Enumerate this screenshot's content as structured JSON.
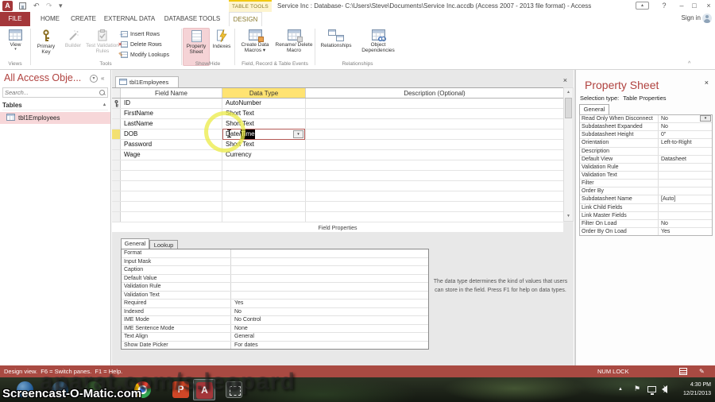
{
  "window": {
    "title": "Service Inc : Database- C:\\Users\\Steve\\Documents\\Service Inc.accdb (Access 2007 - 2013 file format) - Access",
    "app_initial": "A",
    "contextual_group": "TABLE TOOLS",
    "sign_in": "Sign in"
  },
  "tabs": {
    "file": "FILE",
    "home": "HOME",
    "create": "CREATE",
    "external_data": "EXTERNAL DATA",
    "database_tools": "DATABASE TOOLS",
    "design": "DESIGN"
  },
  "ribbon": {
    "view": "View",
    "primary_key": "Primary Key",
    "builder": "Builder",
    "test_validation_rules": "Test Validation Rules",
    "insert_rows": "Insert Rows",
    "delete_rows": "Delete Rows",
    "modify_lookups": "Modify Lookups",
    "property_sheet": "Property Sheet",
    "indexes": "Indexes",
    "create_data_macros": "Create Data Macros ▾",
    "rename_delete_macro": "Rename/ Delete Macro",
    "relationships": "Relationships",
    "object_dependencies": "Object Dependencies",
    "groups": {
      "views": "Views",
      "tools": "Tools",
      "showhide": "Show/Hide",
      "events": "Field, Record & Table Events",
      "relationships": "Relationships"
    }
  },
  "nav": {
    "title": "All Access Obje...",
    "search_placeholder": "Search...",
    "section": "Tables",
    "items": [
      {
        "label": "tbl1Employees"
      }
    ]
  },
  "doc": {
    "tab": "tbl1Employees",
    "grid_headers": {
      "field": "Field Name",
      "type": "Data Type",
      "desc": "Description (Optional)"
    },
    "rows": [
      {
        "name": "ID",
        "type": "AutoNumber"
      },
      {
        "name": "FirstName",
        "type": "Short Text"
      },
      {
        "name": "LastName",
        "type": "Short Text"
      },
      {
        "name": "DOB",
        "type_prefix": "Date/",
        "type_selected": "Time"
      },
      {
        "name": "Password",
        "type": "Short Text"
      },
      {
        "name": "Wage",
        "type": "Currency"
      }
    ],
    "field_properties": {
      "label": "Field Properties",
      "tab_general": "General",
      "tab_lookup": "Lookup",
      "rows": [
        {
          "label": "Format",
          "value": ""
        },
        {
          "label": "Input Mask",
          "value": ""
        },
        {
          "label": "Caption",
          "value": ""
        },
        {
          "label": "Default Value",
          "value": ""
        },
        {
          "label": "Validation Rule",
          "value": ""
        },
        {
          "label": "Validation Text",
          "value": ""
        },
        {
          "label": "Required",
          "value": "Yes"
        },
        {
          "label": "Indexed",
          "value": "No"
        },
        {
          "label": "IME Mode",
          "value": "No Control"
        },
        {
          "label": "IME Sentence Mode",
          "value": "None"
        },
        {
          "label": "Text Align",
          "value": "General"
        },
        {
          "label": "Show Date Picker",
          "value": "For dates"
        }
      ],
      "help": "The data type determines the kind of values that users can store in the field. Press F1 for help on data types."
    }
  },
  "property_sheet": {
    "title": "Property Sheet",
    "selection_label": "Selection type:",
    "selection_value": "Table Properties",
    "tab": "General",
    "rows": [
      {
        "label": "Read Only When Disconnect",
        "value": "No"
      },
      {
        "label": "Subdatasheet Expanded",
        "value": "No"
      },
      {
        "label": "Subdatasheet Height",
        "value": "0\""
      },
      {
        "label": "Orientation",
        "value": "Left-to-Right"
      },
      {
        "label": "Description",
        "value": ""
      },
      {
        "label": "Default View",
        "value": "Datasheet"
      },
      {
        "label": "Validation Rule",
        "value": ""
      },
      {
        "label": "Validation Text",
        "value": ""
      },
      {
        "label": "Filter",
        "value": ""
      },
      {
        "label": "Order By",
        "value": ""
      },
      {
        "label": "Subdatasheet Name",
        "value": "[Auto]"
      },
      {
        "label": "Link Child Fields",
        "value": ""
      },
      {
        "label": "Link Master Fields",
        "value": ""
      },
      {
        "label": "Filter On Load",
        "value": "No"
      },
      {
        "label": "Order By On Load",
        "value": "Yes"
      }
    ]
  },
  "status": {
    "left": "Design view.  F6 = Switch panes.  F1 = Help.",
    "num_lock": "NUM LOCK"
  },
  "taskbar": {
    "ppt_initial": "P",
    "access_initial": "A",
    "clock_time": "4:30 PM",
    "clock_date": "12/21/2013"
  },
  "watermarks": {
    "large": "aparat.com/s.leopard",
    "small": "Screencast-O-Matic.com"
  },
  "icons": {
    "dropdown": "▾",
    "close": "×",
    "minimize": "–",
    "restore": "□",
    "help": "?",
    "undo": "↶",
    "redo": "↷",
    "collapse_left": "«",
    "chevron_down": "▾",
    "chevron_up": "▴",
    "scroll_up": "▲",
    "scroll_down": "▼",
    "tray_up": "▲",
    "flag": "⚑",
    "ribbon_collapse": "^",
    "delete_x": "×",
    "insert_arrow": "→",
    "pencil": "✎"
  },
  "colors": {
    "accent_red": "#a4373a",
    "contextual_yellow": "#f2c811",
    "selection_pink": "#f7d7d9",
    "datatype_header_yellow": "#ffe372",
    "status_red": "#a94a42"
  }
}
